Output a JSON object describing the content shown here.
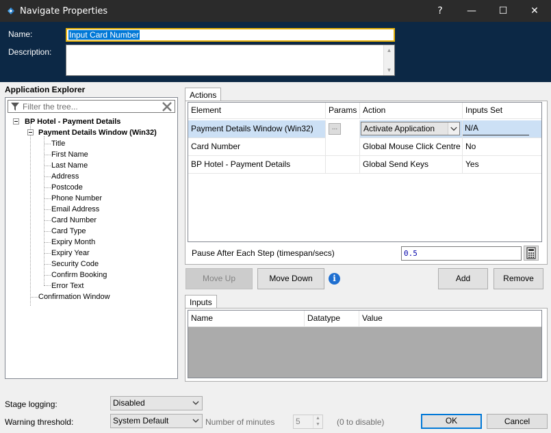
{
  "window": {
    "title": "Navigate Properties",
    "help_glyph": "?",
    "min_glyph": "—",
    "max_glyph": "☐",
    "close_glyph": "✕"
  },
  "header": {
    "name_label": "Name:",
    "name_value": "Input Card Number",
    "description_label": "Description:",
    "description_value": ""
  },
  "explorer": {
    "title": "Application Explorer",
    "filter_placeholder": "Filter the tree...",
    "root": "BP Hotel - Payment Details",
    "window_node": "Payment Details Window (Win32)",
    "children": [
      "Title",
      "First Name",
      "Last Name",
      "Address",
      "Postcode",
      "Phone Number",
      "Email Address",
      "Card Number",
      "Card Type",
      "Expiry Month",
      "Expiry Year",
      "Security Code",
      "Confirm Booking",
      "Error Text"
    ],
    "sibling": "Confirmation Window"
  },
  "actions": {
    "tab_label": "Actions",
    "columns": [
      "Element",
      "Params",
      "Action",
      "Inputs Set"
    ],
    "rows": [
      {
        "element": "Payment Details Window (Win32)",
        "params": "...",
        "action": "Activate Application",
        "inputs_set": "N/A"
      },
      {
        "element": "Card Number",
        "params": "",
        "action": "Global Mouse Click Centre",
        "inputs_set": "No"
      },
      {
        "element": "BP Hotel - Payment Details",
        "params": "",
        "action": "Global Send Keys",
        "inputs_set": "Yes"
      }
    ],
    "pause_label": "Pause After Each Step (timespan/secs)",
    "pause_value": "0.5",
    "move_up": "Move Up",
    "move_down": "Move Down",
    "add": "Add",
    "remove": "Remove"
  },
  "inputs": {
    "tab_label": "Inputs",
    "columns": [
      "Name",
      "Datatype",
      "Value"
    ]
  },
  "footer": {
    "stage_logging_label": "Stage logging:",
    "stage_logging_value": "Disabled",
    "warning_label": "Warning threshold:",
    "warning_value": "System Default",
    "minutes_label": "Number of minutes",
    "minutes_value": "5",
    "disable_hint": "(0 to disable)",
    "ok": "OK",
    "cancel": "Cancel"
  },
  "colors": {
    "header_bg": "#0c2845",
    "titlebar_bg": "#2b2b2b",
    "focus_border": "#e8b30a",
    "selection": "#cce0f5"
  }
}
